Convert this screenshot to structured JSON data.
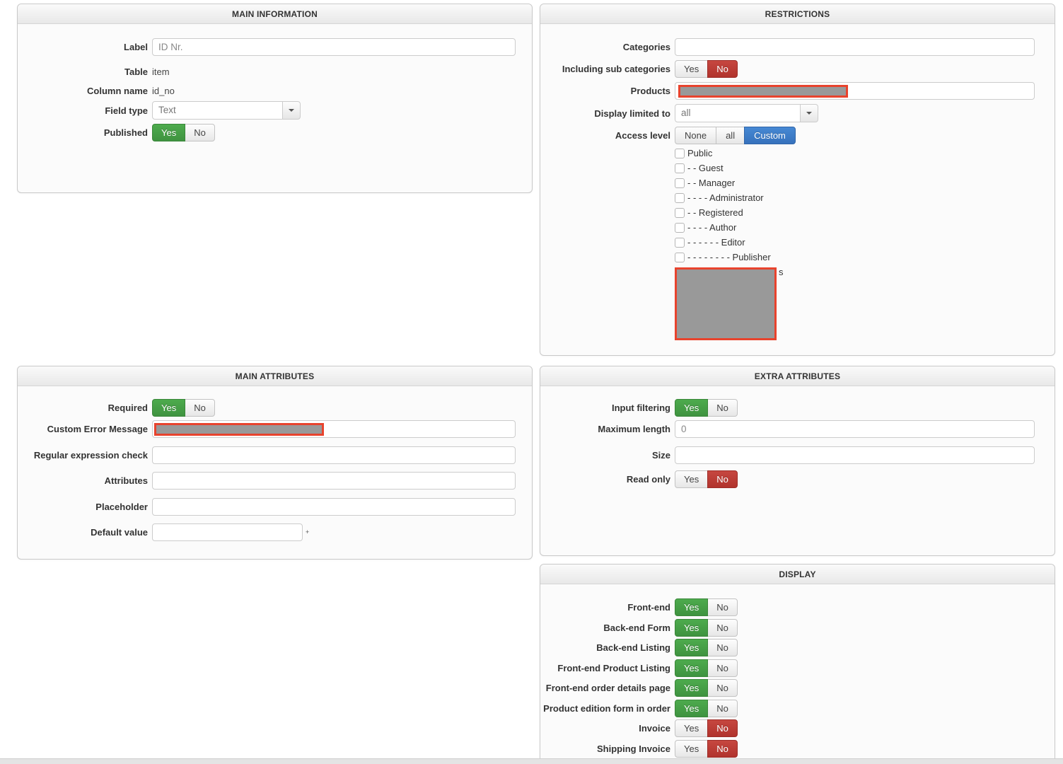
{
  "toggle": {
    "yes": "Yes",
    "no": "No"
  },
  "colors": {
    "toggle_yes_selected": "#46a046",
    "toggle_no_selected": "#bb3a33",
    "access_custom_selected": "#3d7ec9",
    "redaction_fill": "#999999",
    "redaction_border": "#e8432d"
  },
  "panels": {
    "main_information": {
      "title": "MAIN INFORMATION",
      "fields": {
        "label": {
          "label": "Label",
          "value": "ID Nr."
        },
        "table": {
          "label": "Table",
          "value": "item"
        },
        "column_name": {
          "label": "Column name",
          "value": "id_no"
        },
        "field_type": {
          "label": "Field type",
          "value": "Text"
        },
        "published": {
          "label": "Published",
          "state": "yes"
        }
      }
    },
    "restrictions": {
      "title": "RESTRICTIONS",
      "fields": {
        "categories": {
          "label": "Categories",
          "value": ""
        },
        "including_sub_categories": {
          "label": "Including sub categories",
          "state": "no"
        },
        "products": {
          "label": "Products",
          "value": "",
          "redacted": true
        },
        "display_limited_to": {
          "label": "Display limited to",
          "value": "all"
        },
        "access_level": {
          "label": "Access level",
          "options": [
            "None",
            "all",
            "Custom"
          ],
          "state": "custom"
        }
      },
      "access_level_groups": [
        {
          "label": "Public",
          "checked": false
        },
        {
          "label": "- - Guest",
          "checked": false
        },
        {
          "label": "- - Manager",
          "checked": false
        },
        {
          "label": "- - - - Administrator",
          "checked": false
        },
        {
          "label": "- - Registered",
          "checked": false
        },
        {
          "label": "- - - - Author",
          "checked": false
        },
        {
          "label": "- - - - - - Editor",
          "checked": false
        },
        {
          "label": "- - - - - - - - Publisher",
          "checked": false
        }
      ],
      "partially_hidden_text": "s"
    },
    "main_attributes": {
      "title": "MAIN ATTRIBUTES",
      "fields": {
        "required": {
          "label": "Required",
          "state": "yes"
        },
        "custom_error_message": {
          "label": "Custom Error Message",
          "value": "",
          "redacted": true
        },
        "regular_expression_check": {
          "label": "Regular expression check",
          "value": ""
        },
        "attributes": {
          "label": "Attributes",
          "value": ""
        },
        "placeholder": {
          "label": "Placeholder",
          "value": ""
        },
        "default_value": {
          "label": "Default value",
          "value": "",
          "marker": "+"
        }
      }
    },
    "extra_attributes": {
      "title": "EXTRA ATTRIBUTES",
      "fields": {
        "input_filtering": {
          "label": "Input filtering",
          "state": "yes"
        },
        "maximum_length": {
          "label": "Maximum length",
          "value": "0"
        },
        "size": {
          "label": "Size",
          "value": ""
        },
        "read_only": {
          "label": "Read only",
          "state": "no"
        }
      }
    },
    "display": {
      "title": "DISPLAY",
      "rows": [
        {
          "label": "Front-end",
          "state": "yes"
        },
        {
          "label": "Back-end Form",
          "state": "yes"
        },
        {
          "label": "Back-end Listing",
          "state": "yes"
        },
        {
          "label": "Front-end Product Listing",
          "state": "yes"
        },
        {
          "label": "Front-end order details page",
          "state": "yes"
        },
        {
          "label": "Product edition form in order",
          "state": "yes"
        },
        {
          "label": "Invoice",
          "state": "no"
        },
        {
          "label": "Shipping Invoice",
          "state": "no"
        }
      ]
    }
  }
}
